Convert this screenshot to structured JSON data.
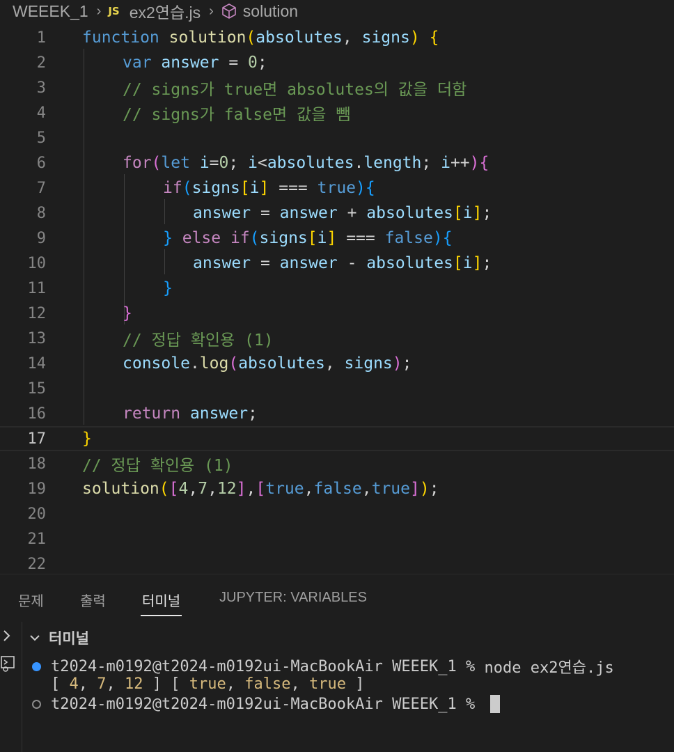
{
  "breadcrumb": {
    "folder": "WEEEK_1",
    "file_badge": "JS",
    "file": "ex2연습.js",
    "symbol": "solution"
  },
  "editor": {
    "current_line": 17,
    "line_numbers": [
      "1",
      "2",
      "3",
      "4",
      "5",
      "6",
      "7",
      "8",
      "9",
      "10",
      "11",
      "12",
      "13",
      "14",
      "15",
      "16",
      "17",
      "18",
      "19",
      "20",
      "21",
      "22"
    ],
    "tokens": {
      "l1": [
        "function",
        " ",
        "solution",
        "(",
        "absolutes",
        ", ",
        "signs",
        ")",
        " ",
        "{"
      ],
      "l2": [
        "var",
        " ",
        "answer",
        " = ",
        "0",
        ";"
      ],
      "l3": [
        "// signs가 true면 absolutes의 값을 더함"
      ],
      "l4": [
        "// signs가 false면 값을 뺌"
      ],
      "l6": [
        "for",
        "(",
        "let",
        " ",
        "i",
        "=",
        "0",
        "; ",
        "i",
        "<",
        "absolutes",
        ".",
        "length",
        "; ",
        "i",
        "++",
        ")",
        "{"
      ],
      "l7": [
        "if",
        "(",
        "signs",
        "[",
        "i",
        "]",
        " === ",
        "true",
        ")",
        "{"
      ],
      "l8": [
        "answer",
        " = ",
        "answer",
        " + ",
        "absolutes",
        "[",
        "i",
        "]",
        ";"
      ],
      "l9": [
        "}",
        " ",
        "else",
        " ",
        "if",
        "(",
        "signs",
        "[",
        "i",
        "]",
        " === ",
        "false",
        ")",
        "{"
      ],
      "l10": [
        "answer",
        " = ",
        "answer",
        " - ",
        "absolutes",
        "[",
        "i",
        "]",
        ";"
      ],
      "l11": [
        "}"
      ],
      "l12": [
        "}"
      ],
      "l13": [
        "// 정답 확인용 (1)"
      ],
      "l14": [
        "console",
        ".",
        "log",
        "(",
        "absolutes",
        ", ",
        "signs",
        ")",
        ";"
      ],
      "l16": [
        "return",
        " ",
        "answer",
        ";"
      ],
      "l17": [
        "}"
      ],
      "l18": [
        "// 정답 확인용 (1)"
      ],
      "l19": [
        "solution",
        "(",
        "[",
        "4",
        ",",
        "7",
        ",",
        "12",
        "]",
        ",",
        "[",
        "true",
        ",",
        "false",
        ",",
        "true",
        "]",
        ")",
        ";"
      ]
    }
  },
  "panel": {
    "tabs": [
      "문제",
      "출력",
      "터미널",
      "JUPYTER: VARIABLES"
    ],
    "active_tab": "터미널",
    "terminal_header": "터미널",
    "terminal_lines": {
      "cmd_prompt": "t2024-m0192@t2024-m0192ui-MacBookAir WEEEK_1 % ",
      "cmd": "node ex2연습.js",
      "out": [
        "[ ",
        "4",
        ", ",
        "7",
        ", ",
        "12",
        " ] [ ",
        "true",
        ", ",
        "false",
        ", ",
        "true",
        " ]"
      ],
      "prompt": "t2024-m0192@t2024-m0192ui-MacBookAir WEEEK_1 % "
    }
  },
  "colors": {
    "keyword": "#569cd6",
    "control": "#c586c0",
    "function": "#dcdcaa",
    "variable": "#9cdcfe",
    "number": "#b5cea8",
    "comment": "#6a9955",
    "bracket1": "#ffd700",
    "bracket2": "#da70d6",
    "bracket3": "#179fff",
    "terminal_accent": "#3794ff"
  }
}
